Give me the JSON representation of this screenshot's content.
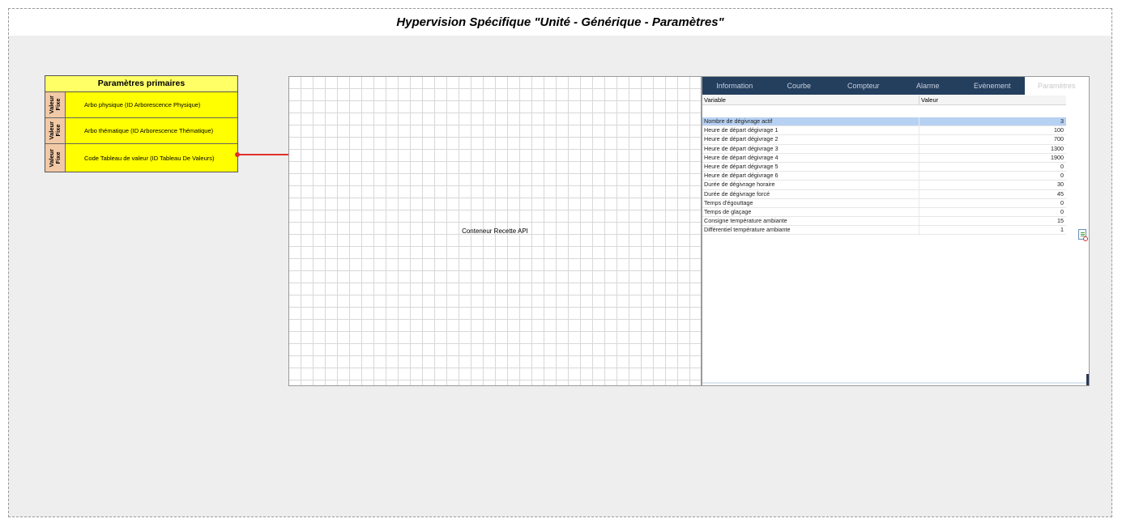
{
  "title": "Hypervision Spécifique \"Unité - Générique - Paramètres\"",
  "params": {
    "header": "Paramètres primaires",
    "rows": [
      {
        "tag": "Valeur\nFixe",
        "label": "Arbo physique (ID Arborescence Physique)"
      },
      {
        "tag": "Valeur\nFixe",
        "label": "Arbo thématique (ID Arborescence Thématique)"
      },
      {
        "tag": "Valeur\nFixe",
        "label": "Code Tableau de valeur (ID Tableau De Valeurs)"
      }
    ]
  },
  "grid": {
    "label": "Conteneur Recette API"
  },
  "panel": {
    "tabs": [
      "Information",
      "Courbe",
      "Compteur",
      "Alarme",
      "Evènement",
      "Paramètres"
    ],
    "active_tab": "Paramètres",
    "columns": [
      "Variable",
      "Valeur"
    ],
    "rows": [
      {
        "name": "Nombre de dégivrage actif",
        "value": "3"
      },
      {
        "name": "Heure de départ dégivrage 1",
        "value": "100"
      },
      {
        "name": "Heure de départ dégivrage 2",
        "value": "700"
      },
      {
        "name": "Heure de départ dégivrage 3",
        "value": "1300"
      },
      {
        "name": "Heure de départ dégivrage 4",
        "value": "1900"
      },
      {
        "name": "Heure de départ dégivrage 5",
        "value": "0"
      },
      {
        "name": "Heure de départ dégivrage 6",
        "value": "0"
      },
      {
        "name": "Durée de dégivrage horaire",
        "value": "30"
      },
      {
        "name": "Durée de dégivrage forcé",
        "value": "45"
      },
      {
        "name": "Temps d'égouttage",
        "value": "0"
      },
      {
        "name": "Temps de glaçage",
        "value": "0"
      },
      {
        "name": "Consigne température ambiante",
        "value": "15"
      },
      {
        "name": "Différentiel température ambiante",
        "value": "1"
      }
    ],
    "selected_row": 0
  },
  "colors": {
    "connector": "#e0302c",
    "tabbar": "#243e5e",
    "selected_row": "#b7d1f3",
    "params_bg": "#ffff00"
  }
}
